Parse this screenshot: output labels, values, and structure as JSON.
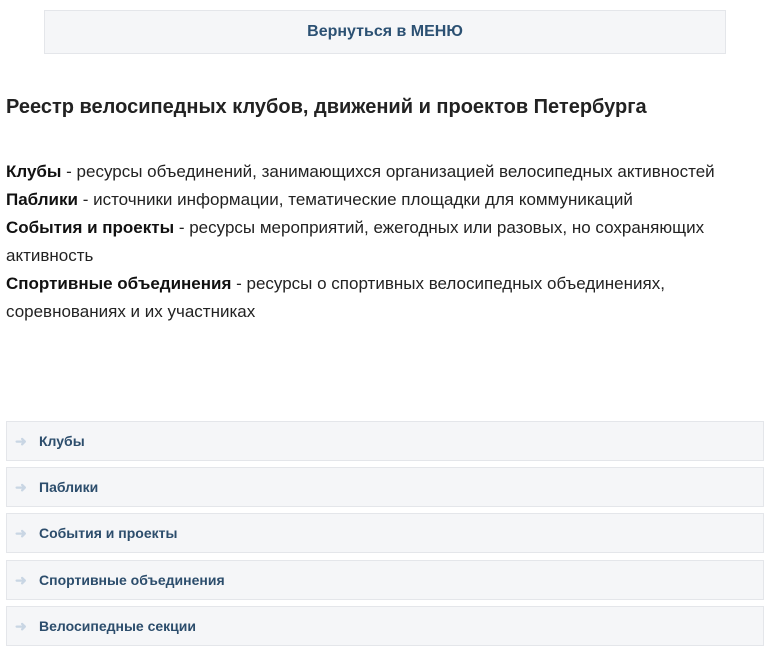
{
  "menu_button": "Вернуться в МЕНЮ",
  "title": "Реестр велосипедных клубов, движений и проектов Петербурга",
  "descriptions": [
    {
      "term": "Клубы",
      "text": " - ресурсы объединений, занимающихся организацией велосипедных активностей"
    },
    {
      "term": "Паблики",
      "text": " - источники информации, тематические площадки для коммуникаций"
    },
    {
      "term": "События и проекты",
      "text": " - ресурсы мероприятий, ежегодных или разовых, но сохраняющих активность"
    },
    {
      "term": "Спортивные объединения",
      "text": " - ресурсы о спортивных велосипедных объединениях, соревнованиях и их участниках"
    }
  ],
  "sections": [
    "Клубы",
    "Паблики",
    "События и проекты",
    "Спортивные объединения",
    "Велосипедные секции"
  ]
}
